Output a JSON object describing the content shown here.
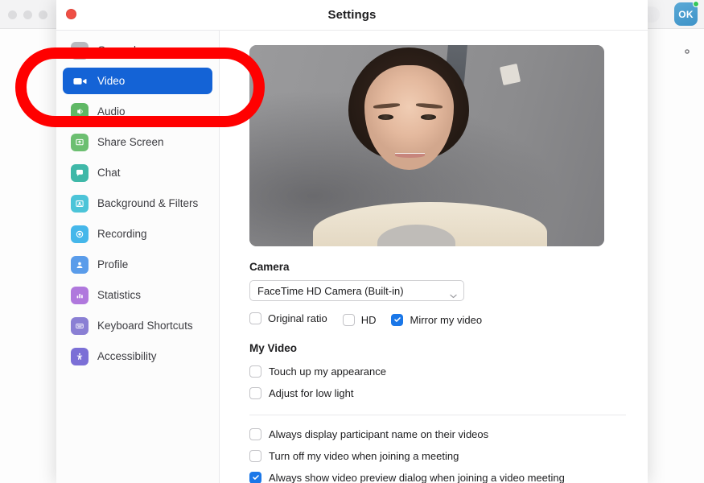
{
  "window": {
    "title": "Settings",
    "close_button": "close",
    "accent_color": "#1463d6",
    "checked_color": "#1a77e8",
    "annotation_color": "#ff0000"
  },
  "desktop": {
    "ok_badge_label": "OK",
    "status_dot_color": "#34c759",
    "gear_icon": "gear-icon",
    "traffic_lights": [
      "close",
      "minimize",
      "maximize"
    ]
  },
  "sidebar": {
    "items": [
      {
        "label": "General",
        "icon": "gear-icon",
        "color": "#b9b9be",
        "active": false
      },
      {
        "label": "Video",
        "icon": "video-camera-icon",
        "color": "#1463d6",
        "active": true
      },
      {
        "label": "Audio",
        "icon": "speaker-icon",
        "color": "#5fb865",
        "active": false
      },
      {
        "label": "Share Screen",
        "icon": "share-screen-icon",
        "color": "#6cbf71",
        "active": false
      },
      {
        "label": "Chat",
        "icon": "chat-bubble-icon",
        "color": "#3fb8a8",
        "active": false
      },
      {
        "label": "Background & Filters",
        "icon": "background-filters-icon",
        "color": "#4cc4d8",
        "active": false
      },
      {
        "label": "Recording",
        "icon": "recording-icon",
        "color": "#45b7ea",
        "active": false
      },
      {
        "label": "Profile",
        "icon": "profile-icon",
        "color": "#5a9cea",
        "active": false
      },
      {
        "label": "Statistics",
        "icon": "statistics-icon",
        "color": "#b078dd",
        "active": false
      },
      {
        "label": "Keyboard Shortcuts",
        "icon": "keyboard-icon",
        "color": "#8a7fd4",
        "active": false
      },
      {
        "label": "Accessibility",
        "icon": "accessibility-icon",
        "color": "#7b6fd6",
        "active": false
      }
    ]
  },
  "content": {
    "video_preview_alt": "camera self view",
    "camera": {
      "heading": "Camera",
      "selected_device": "FaceTime HD Camera (Built-in)",
      "options": [
        {
          "label": "Original ratio",
          "checked": false
        },
        {
          "label": "HD",
          "checked": false
        },
        {
          "label": "Mirror my video",
          "checked": true
        }
      ]
    },
    "my_video": {
      "heading": "My Video",
      "options": [
        {
          "label": "Touch up my appearance",
          "checked": false
        },
        {
          "label": "Adjust for low light",
          "checked": false
        }
      ]
    },
    "meetings": {
      "options": [
        {
          "label": "Always display participant name on their videos",
          "checked": false
        },
        {
          "label": "Turn off my video when joining a meeting",
          "checked": false
        },
        {
          "label": "Always show video preview dialog when joining a video meeting",
          "checked": true
        }
      ]
    }
  }
}
